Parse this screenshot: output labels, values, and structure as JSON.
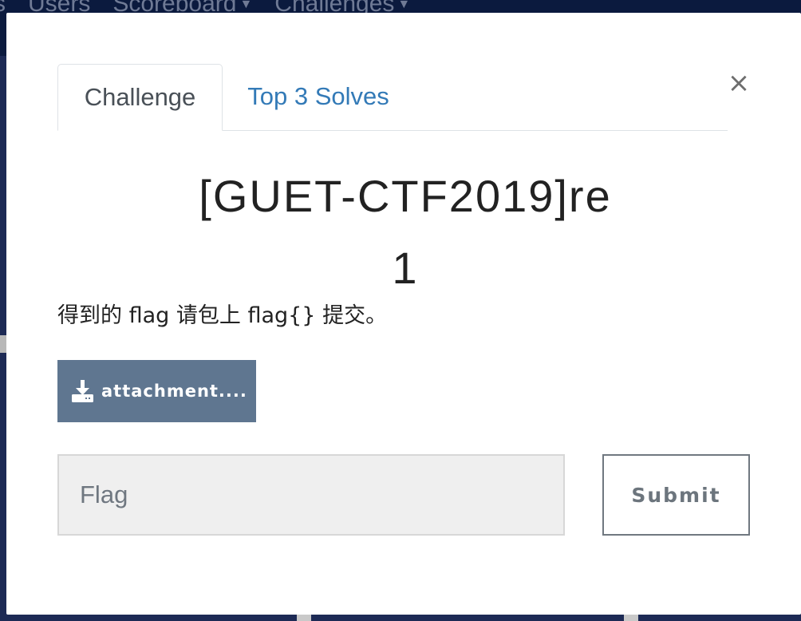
{
  "background": {
    "nav_items": [
      "s",
      "Users",
      "Scoreboard",
      "Challenges"
    ]
  },
  "modal": {
    "close_symbol": "×",
    "tabs": [
      {
        "label": "Challenge",
        "active": true
      },
      {
        "label": "Top 3 Solves",
        "active": false
      }
    ],
    "challenge": {
      "title_line1": "[GUET-CTF2019]re",
      "title_line2": "1",
      "description": "得到的 flag 请包上 flag{} 提交。",
      "attachment_label": "attachment....",
      "attachment_icon": "download-icon"
    },
    "flag_input": {
      "placeholder": "Flag",
      "value": ""
    },
    "submit_label": "Submit"
  },
  "colors": {
    "tab_link": "#337ab7",
    "attachment_button": "#5f7690",
    "submit_border": "#707880"
  }
}
